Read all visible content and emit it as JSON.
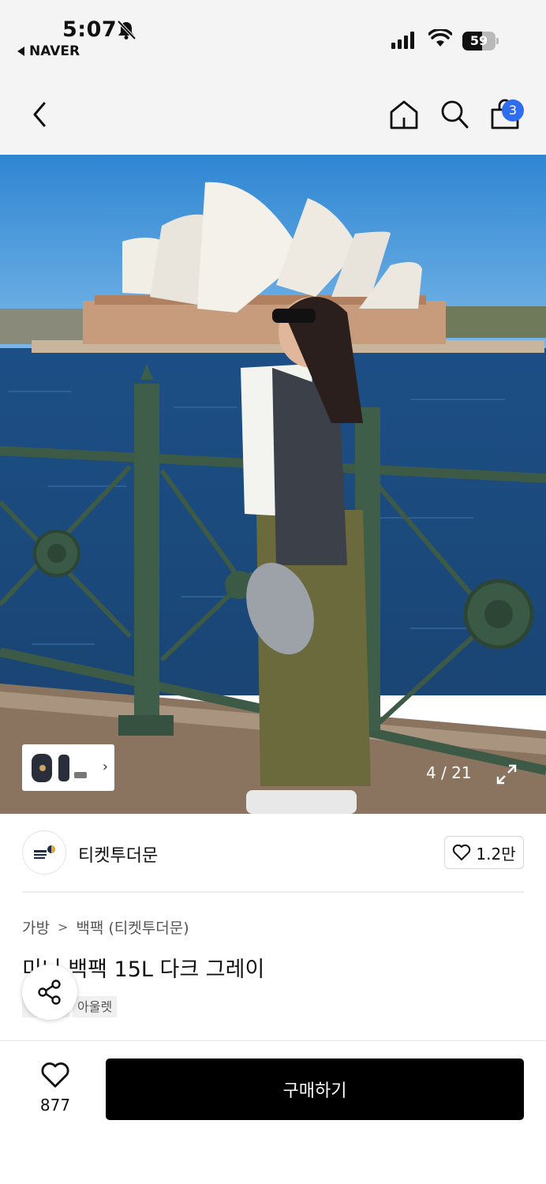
{
  "status_bar": {
    "time": "5:07",
    "back_app": "NAVER",
    "battery_level": "59",
    "battery_fraction": 0.59
  },
  "nav": {
    "cart_count": "3",
    "icons": [
      "back-arrow-icon",
      "home-icon",
      "search-icon",
      "shopping-bag-icon"
    ]
  },
  "gallery": {
    "counter": "4 / 21"
  },
  "store": {
    "name": "티켓투더문",
    "favorite_count": "1.2만"
  },
  "product": {
    "breadcrumb": [
      "가방",
      "백팩 (티켓투더문)"
    ],
    "title": "미니 백팩 15L 다크 그레이",
    "tags": [
      "",
      "아울렛"
    ]
  },
  "bottom_bar": {
    "like_count": "877",
    "buy_label": "구매하기"
  },
  "colors": {
    "accent_badge": "#2f6df0",
    "buy_button": "#000000",
    "header_bg": "#f4f4f4"
  }
}
